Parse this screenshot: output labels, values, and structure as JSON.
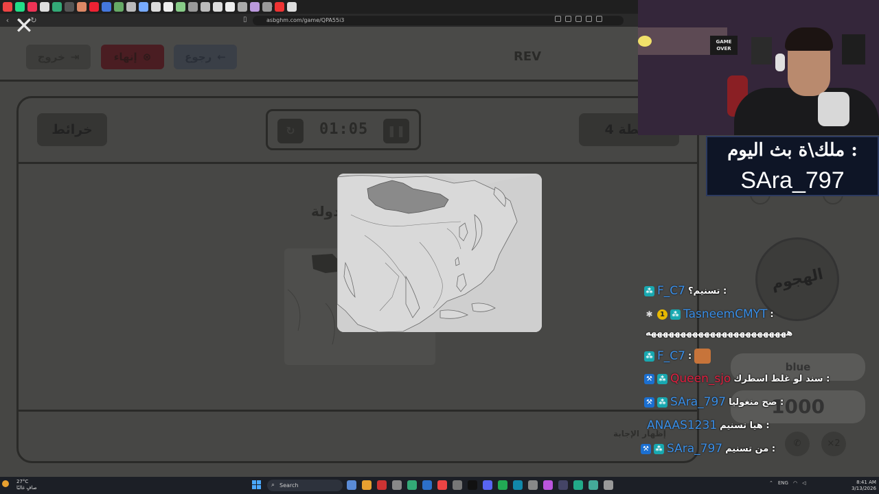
{
  "browser": {
    "url": "asbghm.com/game/QPA55i3",
    "tab_colors": [
      "#e44",
      "#2d8",
      "#e35",
      "#ddd",
      "#3a7",
      "#555",
      "#d86",
      "#e23",
      "#47d",
      "#6a6",
      "#bbb",
      "#7af",
      "#ddd",
      "#eee",
      "#8c8",
      "#999",
      "#bbb",
      "#ddd",
      "#eee",
      "#aaa",
      "#b9d",
      "#999",
      "#e33",
      "#ddd"
    ]
  },
  "game": {
    "topbar": {
      "exit_label": "خروج",
      "end_label": "إنهاء",
      "back_label": "رجوع",
      "team_name": "REV"
    },
    "maps_label": "خرائط",
    "timer": "01:05",
    "points_label": "4 نقطة",
    "question_partial": "دولة",
    "show_answer": "إظهار الإجابة",
    "helper_label": "الهجوم",
    "team_blue": "blue",
    "score": "1000",
    "multiplier": "×2"
  },
  "stream": {
    "poster_text": "GAME OVER",
    "banner_title": "ملك\\ة بث اليوم :",
    "banner_name": "SAra_797"
  },
  "chat": {
    "messages": [
      {
        "user": "F_C7",
        "color": "#3a8fe8",
        "text": "تسنيم؟ :",
        "badges": [
          "sub"
        ]
      },
      {
        "user": "TasneemCMYT",
        "color": "#3a8fe8",
        "text": ":",
        "badges": [
          "bug",
          "one",
          "sub"
        ]
      },
      {
        "user": "",
        "color": "#fff",
        "text": "ههههههههههههههههههههههههه",
        "badges": []
      },
      {
        "user": "F_C7",
        "color": "#3a8fe8",
        "text": ":",
        "badges": [
          "sub"
        ],
        "emote": true
      },
      {
        "user": "Queen_sjo",
        "color": "#e02040",
        "text": "سند لو غلط اسطرك :",
        "badges": [
          "mod",
          "sub"
        ]
      },
      {
        "user": "SAra_797",
        "color": "#3a8fe8",
        "text": "صح منغوليا :",
        "badges": [
          "mod",
          "sub"
        ]
      },
      {
        "user": "ANAAS1231",
        "color": "#3a8fe8",
        "text": "هيا تسنيم :",
        "badges": []
      },
      {
        "user": "SAra_797",
        "color": "#3a8fe8",
        "text": "من تسنيم :",
        "badges": [
          "mod",
          "sub"
        ]
      }
    ]
  },
  "taskbar": {
    "weather_temp": "27°C",
    "weather_desc": "صافٍ غالبًا",
    "search_placeholder": "Search",
    "language": "ENG",
    "time": "8:41 AM",
    "date": "3/13/2026"
  }
}
